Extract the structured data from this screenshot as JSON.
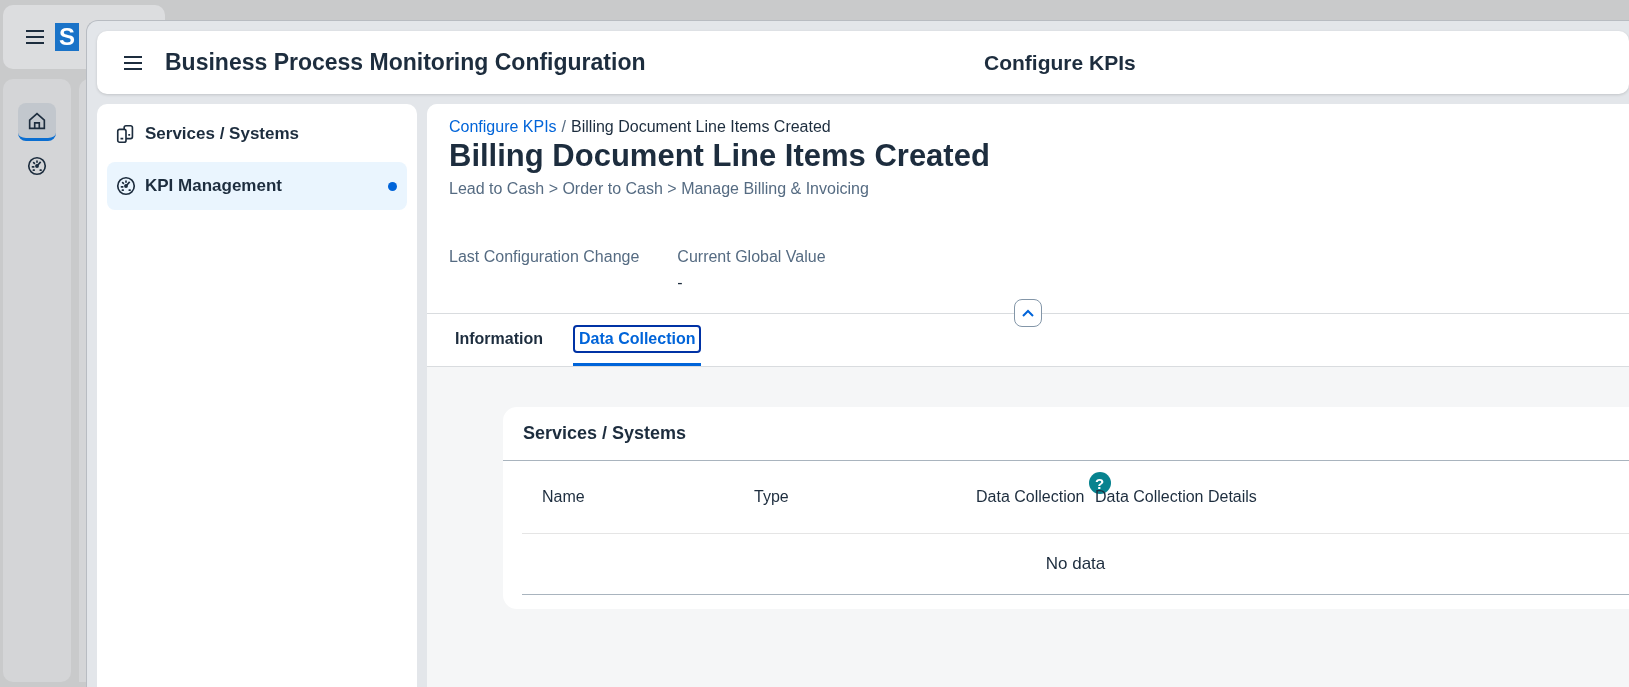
{
  "background_app": {
    "logo_text": "S",
    "rail_items": [
      {
        "kind": "home",
        "selected": true
      },
      {
        "kind": "gauge",
        "selected": false
      }
    ]
  },
  "header": {
    "title": "Business Process Monitoring Configuration",
    "page_title": "Configure KPIs"
  },
  "sidebar": {
    "items": [
      {
        "label": "Services / Systems",
        "kind": "devices",
        "selected": false,
        "indicator": false
      },
      {
        "label": "KPI Management",
        "kind": "gauge",
        "selected": true,
        "indicator": true
      }
    ]
  },
  "object_page": {
    "breadcrumbs": [
      {
        "label": "Configure KPIs",
        "kind": "link"
      },
      {
        "label": "Billing Document Line Items Created",
        "kind": "current"
      }
    ],
    "separator": "/",
    "title": "Billing Document Line Items Created",
    "subtitle": "Lead to Cash > Order to Cash > Manage Billing & Invoicing",
    "attributes": [
      {
        "label": "Last Configuration Change"
      },
      {
        "label": "Current Global Value",
        "value": "-"
      }
    ],
    "tabs": [
      {
        "label": "Information",
        "selected": false,
        "focused": false
      },
      {
        "label": "Data Collection",
        "selected": true,
        "focused": true
      }
    ],
    "section": {
      "title": "Services / Systems",
      "table": {
        "columns": [
          {
            "label": "Name"
          },
          {
            "label": "Type"
          },
          {
            "label": "Data Collection",
            "help_icon": "?"
          },
          {
            "label": "Data Collection Details"
          }
        ],
        "no_data_text": "No data"
      }
    }
  }
}
